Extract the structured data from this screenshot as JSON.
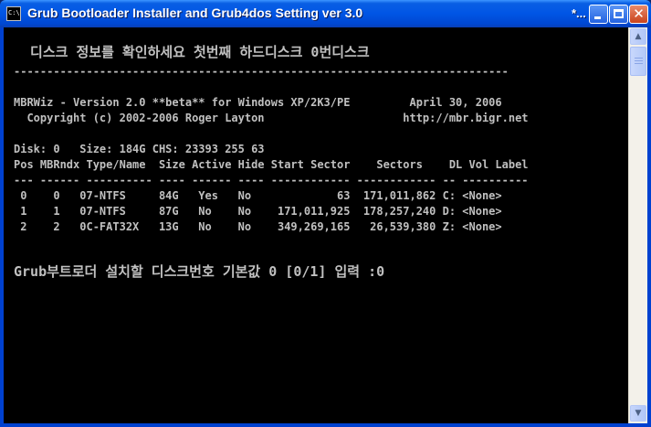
{
  "window": {
    "icon_text": "C:\\",
    "title": "Grub Bootloader Installer and Grub4dos Setting ver 3.0",
    "title_suffix": "*..."
  },
  "console": {
    "heading": "  디스크 정보를 확인하세요 첫번째 하드디스크 0번디스크",
    "separator": "---------------------------------------------------------------------------",
    "mbrwiz_line": "MBRWiz - Version 2.0 **beta** for Windows XP/2K3/PE         April 30, 2006",
    "copyright_line": "  Copyright (c) 2002-2006 Roger Layton                     http://mbr.bigr.net",
    "disk_line": "Disk: 0   Size: 184G CHS: 23393 255 63",
    "table_header": "Pos MBRndx Type/Name  Size Active Hide Start Sector    Sectors    DL Vol Label",
    "table_rule": "--- ------ ---------- ---- ------ ---- ------------ ------------ -- ----------",
    "rows": [
      " 0    0   07-NTFS     84G   Yes   No             63  171,011,862 C: <None>",
      " 1    1   07-NTFS     87G   No    No    171,011,925  178,257,240 D: <None>",
      " 2    2   0C-FAT32X   13G   No    No    349,269,165   26,539,380 Z: <None>"
    ],
    "prompt": "Grub부트로더 설치할 디스크번호 기본값 0 [0/1] 입력 :0"
  }
}
